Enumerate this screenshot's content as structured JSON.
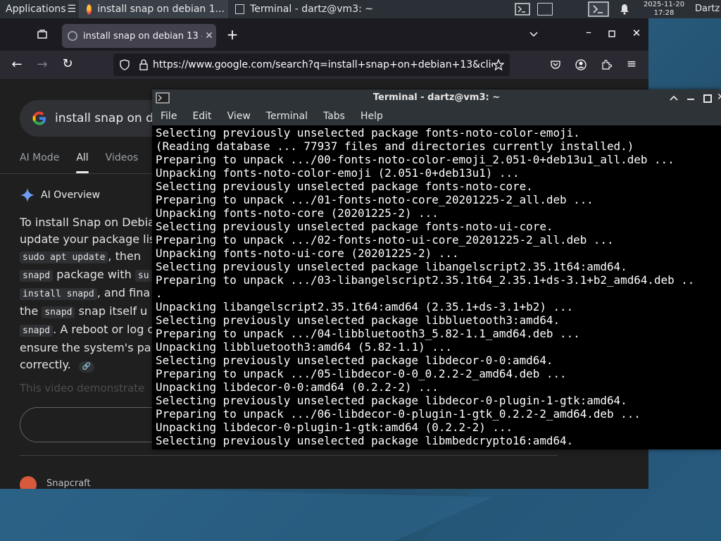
{
  "panel": {
    "apps_label": "Applications",
    "apps_suffix": "☰",
    "tasks": [
      {
        "label": "install snap on debian 1..."
      },
      {
        "label": "Terminal - dartz@vm3: ~"
      }
    ],
    "clock_date": "2025-11-20",
    "clock_time": "17:28",
    "user": "Dartz"
  },
  "browser": {
    "tab_title": "install snap on debian 13 -",
    "url": "https://www.google.com/search?q=install+snap+on+debian+13&client=",
    "search_query": "install snap on de",
    "search_tabs": [
      "AI Mode",
      "All",
      "Videos"
    ],
    "ai_overview": "AI Overview",
    "para": {
      "l1": "To install Snap on Debia",
      "l2": "update your package lis",
      "c1": "sudo apt update",
      "l3": ", then",
      "c2": "snapd",
      "l4": " package with ",
      "c2b": "su",
      "c3": "install snapd",
      "l5": ", and fina",
      "l6a": "the ",
      "c4": "snapd",
      "l6b": " snap itself u",
      "c5": "snapd",
      "l7": ". A reboot or log o",
      "l8": "ensure the system's pa",
      "l9": "correctly."
    },
    "fade_text": "This video demonstrate",
    "snap_source": "Snapcraft"
  },
  "terminal": {
    "title": "Terminal - dartz@vm3: ~",
    "menu": [
      "File",
      "Edit",
      "View",
      "Terminal",
      "Tabs",
      "Help"
    ],
    "lines": [
      "Selecting previously unselected package fonts-noto-color-emoji.",
      "(Reading database ... 77937 files and directories currently installed.)",
      "Preparing to unpack .../00-fonts-noto-color-emoji_2.051-0+deb13u1_all.deb ...",
      "Unpacking fonts-noto-color-emoji (2.051-0+deb13u1) ...",
      "Selecting previously unselected package fonts-noto-core.",
      "Preparing to unpack .../01-fonts-noto-core_20201225-2_all.deb ...",
      "Unpacking fonts-noto-core (20201225-2) ...",
      "Selecting previously unselected package fonts-noto-ui-core.",
      "Preparing to unpack .../02-fonts-noto-ui-core_20201225-2_all.deb ...",
      "Unpacking fonts-noto-ui-core (20201225-2) ...",
      "Selecting previously unselected package libangelscript2.35.1t64:amd64.",
      "Preparing to unpack .../03-libangelscript2.35.1t64_2.35.1+ds-3.1+b2_amd64.deb ..",
      ".",
      "Unpacking libangelscript2.35.1t64:amd64 (2.35.1+ds-3.1+b2) ...",
      "Selecting previously unselected package libbluetooth3:amd64.",
      "Preparing to unpack .../04-libbluetooth3_5.82-1.1_amd64.deb ...",
      "Unpacking libbluetooth3:amd64 (5.82-1.1) ...",
      "Selecting previously unselected package libdecor-0-0:amd64.",
      "Preparing to unpack .../05-libdecor-0-0_0.2.2-2_amd64.deb ...",
      "Unpacking libdecor-0-0:amd64 (0.2.2-2) ...",
      "Selecting previously unselected package libdecor-0-plugin-1-gtk:amd64.",
      "Preparing to unpack .../06-libdecor-0-plugin-1-gtk_0.2.2-2_amd64.deb ...",
      "Unpacking libdecor-0-plugin-1-gtk:amd64 (0.2.2-2) ...",
      "Selecting previously unselected package libmbedcrypto16:amd64."
    ]
  }
}
